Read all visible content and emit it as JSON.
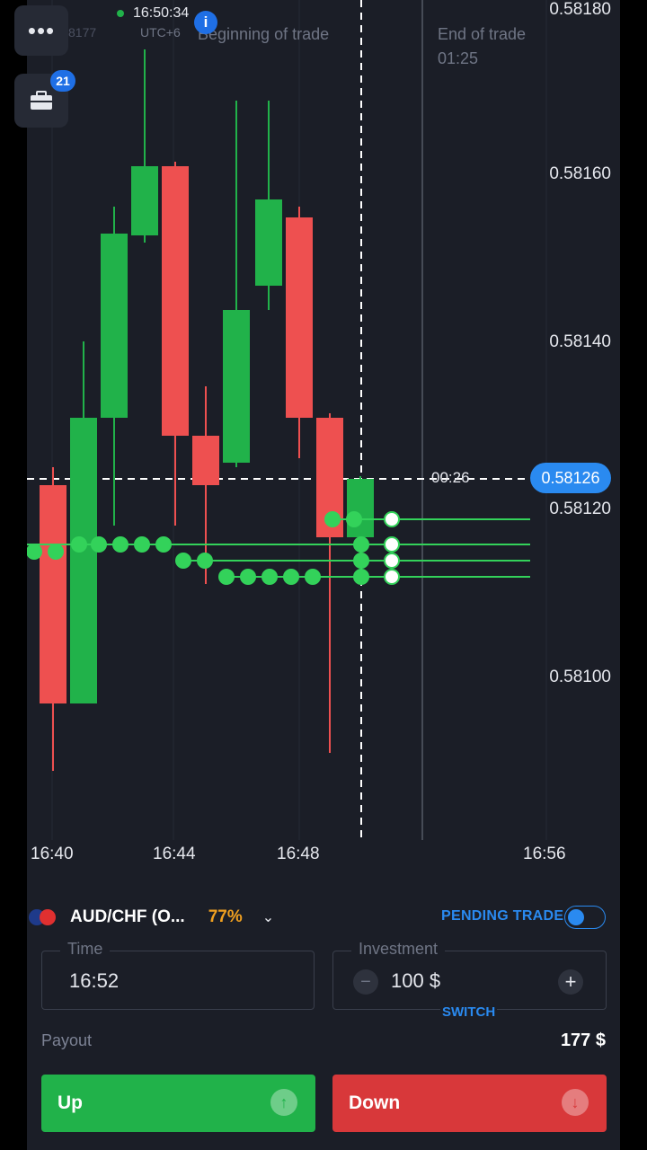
{
  "header": {
    "clock": "16:50:34",
    "timezone": "UTC+6",
    "account_fragment": "8177",
    "beginning_label": "Beginning of trade",
    "end_label": "End of trade",
    "end_time": "01:25",
    "portfolio_count": "21",
    "menu_icon": "more-dots-icon"
  },
  "chart": {
    "price_ticks": [
      "0.58180",
      "0.58160",
      "0.58140",
      "0.58120",
      "0.58100"
    ],
    "time_ticks": [
      "16:40",
      "16:44",
      "16:48",
      "16:56"
    ],
    "current_price": "0.58126",
    "countdown": "00:26",
    "colors": {
      "bull": "#21b24a",
      "bear": "#ee5050",
      "trade_line": "#33d25a"
    }
  },
  "panel": {
    "asset_name": "AUD/CHF (O...",
    "asset_payout": "77%",
    "pending_label": "PENDING TRADE",
    "time_legend": "Time",
    "time_value": "16:52",
    "investment_legend": "Investment",
    "investment_value": "100 $",
    "switch_label": "SWITCH",
    "payout_label": "Payout",
    "payout_value": "177 $",
    "up_label": "Up",
    "down_label": "Down"
  }
}
